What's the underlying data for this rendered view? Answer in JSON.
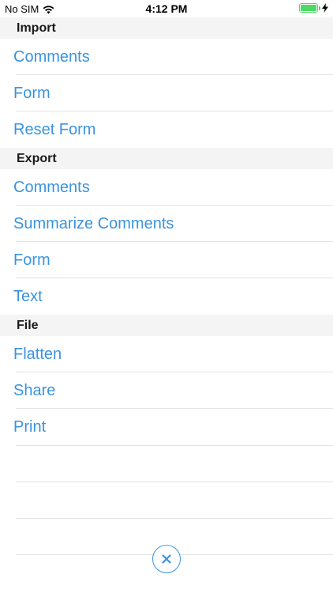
{
  "status_bar": {
    "carrier": "No SIM",
    "time": "4:12 PM",
    "battery_level": 1.0,
    "battery_color": "#4cd964"
  },
  "sections": [
    {
      "title": "Import",
      "items": [
        "Comments",
        "Form",
        "Reset Form"
      ]
    },
    {
      "title": "Export",
      "items": [
        "Comments",
        "Summarize Comments",
        "Form",
        "Text"
      ]
    },
    {
      "title": "File",
      "items": [
        "Flatten",
        "Share",
        "Print"
      ]
    }
  ],
  "colors": {
    "accent": "#3a93e0",
    "section_background": "#f4f4f4",
    "separator": "#e3e3e3"
  },
  "icons": {
    "wifi": "wifi-icon",
    "charging": "bolt-icon",
    "close": "close-icon"
  }
}
